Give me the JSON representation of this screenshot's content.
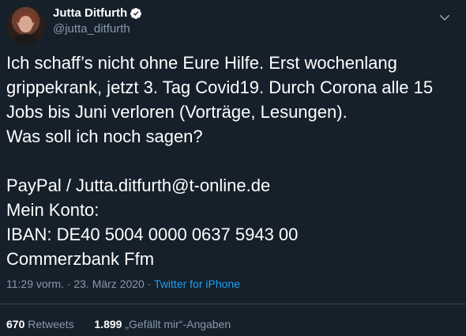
{
  "author": {
    "display_name": "Jutta Ditfurth",
    "handle": "@jutta_ditfurth",
    "verified": true,
    "avatar_icon": "profile-photo"
  },
  "tweet": {
    "text": "Ich schaff’s nicht ohne Eure Hilfe. Erst wochenlang grippekrank, jetzt 3. Tag Covid19. Durch Corona alle 15 Jobs bis Juni verloren (Vorträge, Lesungen).\nWas soll ich noch sagen?\n\nPayPal / Jutta.ditfurth@t-online.de\nMein Konto:\nIBAN: DE40 5004 0000 0637 5943 00\nCommerzbank Ffm",
    "time": "11:29 vorm.",
    "separator": " · ",
    "date": "23. März 2020",
    "source": "Twitter for iPhone"
  },
  "stats": {
    "retweets_count": "670",
    "retweets_label": "Retweets",
    "likes_count": "1.899",
    "likes_label": "„Gefällt mir“-Angaben"
  },
  "colors": {
    "background": "#15202b",
    "text": "#ffffff",
    "secondary": "#8899a6",
    "link": "#1da1f2",
    "divider": "#38444d"
  },
  "icons": {
    "verified": "verified-badge-icon",
    "menu": "chevron-down-icon"
  }
}
